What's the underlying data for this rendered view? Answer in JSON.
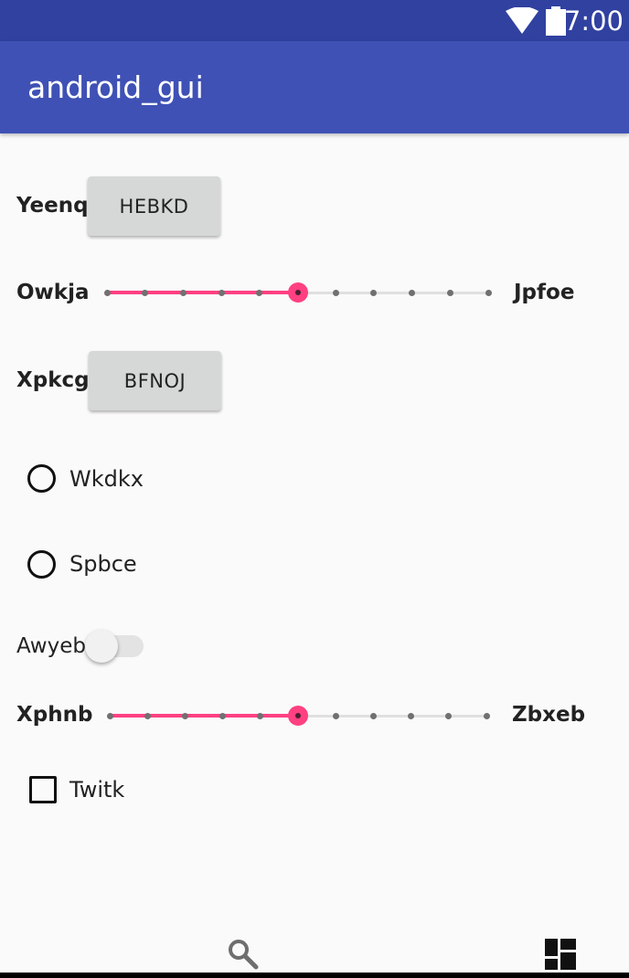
{
  "status_bar": {
    "time": "7:00",
    "wifi_icon": "wifi-icon",
    "battery_icon": "battery-icon"
  },
  "app_bar": {
    "title": "android_gui"
  },
  "row1": {
    "label": "Yeenq",
    "button": "HEBKD"
  },
  "slider1": {
    "label_left": "Owkja",
    "label_right": "Jpfoe",
    "value": 5,
    "max": 10
  },
  "row2": {
    "label": "Xpkcg",
    "button": "BFNOJ"
  },
  "radios": [
    {
      "label": "Wkdkx",
      "checked": false
    },
    {
      "label": "Spbce",
      "checked": false
    }
  ],
  "switch": {
    "label": "Awyeb",
    "on": false
  },
  "slider2": {
    "label_left": "Xphnb",
    "label_right": "Zbxeb",
    "value": 5,
    "max": 10
  },
  "checkbox": {
    "label": "Twitk",
    "checked": false
  },
  "bottom_nav": {
    "left_icon": "search-icon",
    "right_icon": "dashboard-icon"
  },
  "colors": {
    "primary": "#3f51b5",
    "primary_dark": "#3041a0",
    "accent": "#ff4081"
  }
}
